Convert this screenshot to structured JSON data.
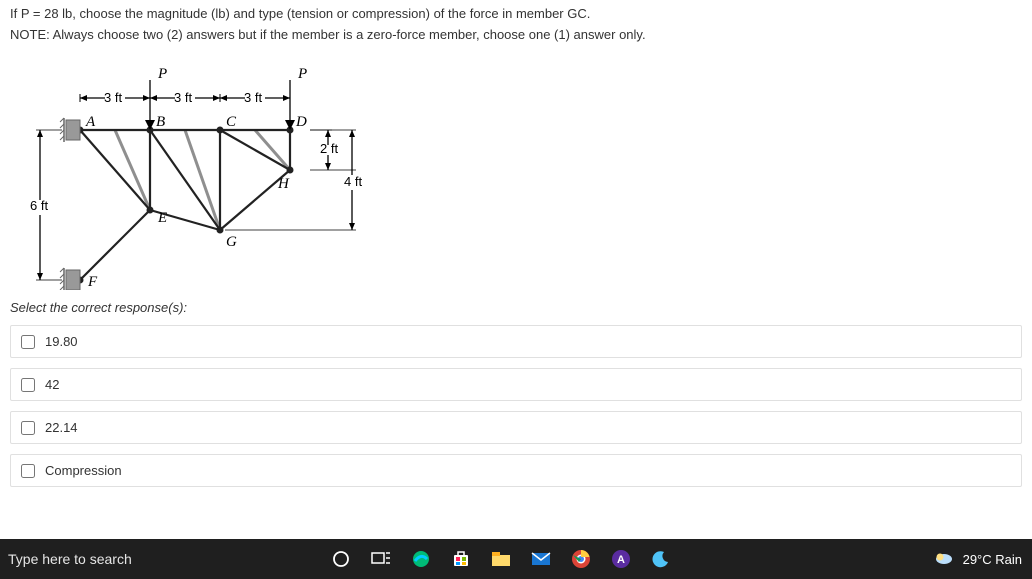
{
  "question": {
    "line1": "If P = 28 lb, choose the magnitude (lb) and type (tension or compression) of the force in member GC.",
    "note": "NOTE: Always choose two (2) answers but if the member is a zero-force member, choose one (1) answer only."
  },
  "diagram": {
    "labels": {
      "A": "A",
      "B": "B",
      "C": "C",
      "D": "D",
      "E": "E",
      "F": "F",
      "G": "G",
      "H": "H",
      "P": "P"
    },
    "dims": {
      "span": "3 ft",
      "h2": "2 ft",
      "h4": "4 ft",
      "h6": "6 ft"
    }
  },
  "instruction": "Select the correct response(s):",
  "options": [
    "19.80",
    "42",
    "22.14",
    "Compression"
  ],
  "taskbar": {
    "search": "Type here to search",
    "weather": "29°C  Rain"
  }
}
